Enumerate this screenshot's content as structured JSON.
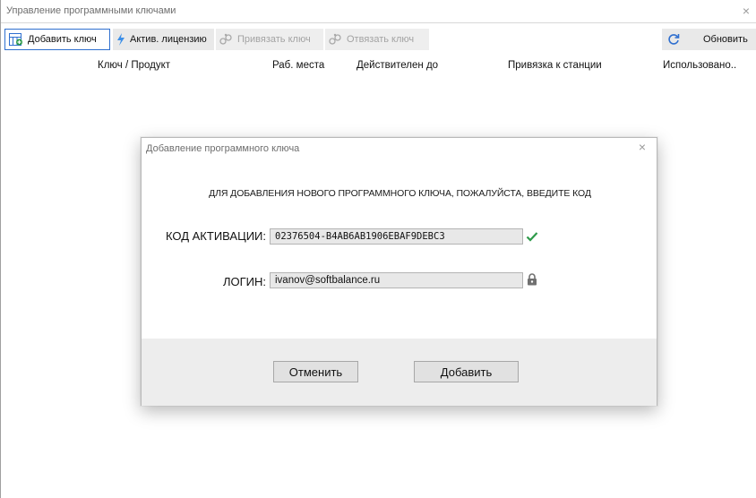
{
  "window": {
    "title": "Управление программными ключами",
    "close_icon": "×"
  },
  "toolbar": {
    "items": [
      {
        "label": "Добавить ключ",
        "icon": "add-key-icon",
        "state": "active"
      },
      {
        "label": "Актив. лицензию",
        "icon": "lightning-icon",
        "state": "enabled"
      },
      {
        "label": "Привязать ключ",
        "icon": "link-icon",
        "state": "disabled"
      },
      {
        "label": "Отвязать ключ",
        "icon": "unlink-icon",
        "state": "disabled"
      },
      {
        "label": "Обновить",
        "icon": "refresh-icon",
        "state": "enabled"
      }
    ]
  },
  "grid": {
    "columns": [
      "Ключ / Продукт",
      "Раб. места",
      "Действителен до",
      "Привязка к станции",
      "Использовано.."
    ]
  },
  "dialog": {
    "title": "Добавление программного ключа",
    "close_icon": "×",
    "message": "ДЛЯ ДОБАВЛЕНИЯ НОВОГО ПРОГРАММНОГО КЛЮЧА, ПОЖАЛУЙСТА, ВВЕДИТЕ КОД",
    "activation_label": "КОД АКТИВАЦИИ:",
    "activation_value": "02376504-B4AB6AB1906EBAF9DEBC3",
    "activation_status_icon": "checkmark-icon",
    "login_label": "ЛОГИН:",
    "login_value": "ivanov@softbalance.ru",
    "login_status_icon": "lock-icon",
    "cancel_label": "Отменить",
    "add_label": "Добавить"
  },
  "colors": {
    "accent": "#2f6fcf",
    "check_green": "#2e9a4a",
    "lightning_blue": "#3c8fe8",
    "disabled_text": "#a3a3a3"
  }
}
